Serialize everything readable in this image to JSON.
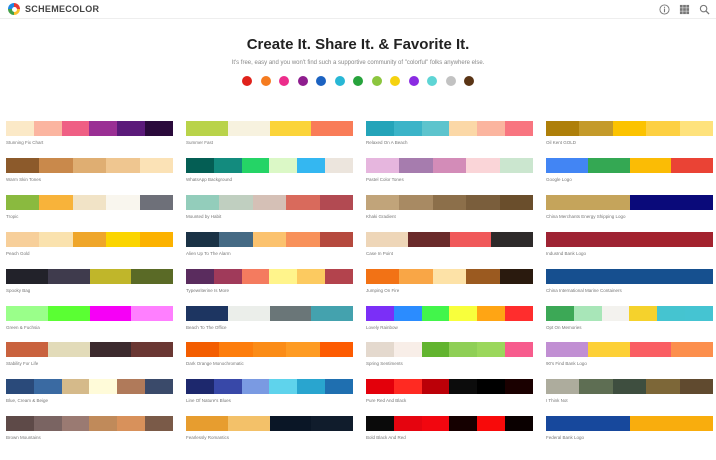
{
  "brand": {
    "name": "SCHEMECOLOR"
  },
  "header_icons": [
    "info-icon",
    "grid-icon",
    "search-icon"
  ],
  "hero": {
    "title": "Create It. Share It. & Favorite It.",
    "subtitle": "It's free, easy and you won't find such a supportive community of \"colorful\" folks anywhere else."
  },
  "color_filters": [
    "#e0221b",
    "#f57c20",
    "#ec2d8b",
    "#8e1d8e",
    "#1b62c1",
    "#28b7d5",
    "#27a33c",
    "#8cc63f",
    "#f5d20f",
    "#8a2be2",
    "#5ed5d5",
    "#c2c2c2",
    "#5a3415"
  ],
  "columns": [
    [
      {
        "name": "Stunning Fix Chart",
        "colors": [
          "#fbe9c7",
          "#fbb5a0",
          "#ef5f84",
          "#9a2f94",
          "#5b1a7a",
          "#2a0a3b"
        ]
      },
      {
        "name": "Warm Skin Tones",
        "colors": [
          "#8c5a2b",
          "#c9894b",
          "#dfae72",
          "#efc690",
          "#fbe2b6"
        ]
      },
      {
        "name": "Tropic",
        "colors": [
          "#8aba3f",
          "#f8b33a",
          "#f1e3c6",
          "#f9f6ee",
          "#6e7079"
        ]
      },
      {
        "name": "Peach Gold",
        "colors": [
          "#f7cf9a",
          "#fae2ae",
          "#efa62a",
          "#fbd500",
          "#fcb200"
        ]
      },
      {
        "name": "Spooky Bag",
        "colors": [
          "#22222a",
          "#3f3b4d",
          "#c0b62a",
          "#5a6a26"
        ]
      },
      {
        "name": "Green & Fuchsia",
        "colors": [
          "#9aff8a",
          "#5aff33",
          "#f600f6",
          "#ff7fff"
        ]
      },
      {
        "name": "Stability For Life",
        "colors": [
          "#c9623e",
          "#e2dbb9",
          "#3c2a2e",
          "#6a3733"
        ]
      },
      {
        "name": "Blue, Cream & Beige",
        "colors": [
          "#2a4a7a",
          "#3a6aa2",
          "#d5ba8a",
          "#fffbd9",
          "#b07a5a",
          "#3a4a6a"
        ]
      },
      {
        "name": "Brown Mountains",
        "colors": [
          "#5e4a48",
          "#7a6462",
          "#9a7a72",
          "#c08a5a",
          "#d8915b",
          "#7a5a48"
        ]
      }
    ],
    [
      {
        "name": "Summer Fast",
        "colors": [
          "#b9d34a",
          "#f7f2df",
          "#fbd43a",
          "#f97c58"
        ]
      },
      {
        "name": "WhatsApp Background",
        "colors": [
          "#045e54",
          "#138b7e",
          "#25d466",
          "#dbf8c6",
          "#34b7f1",
          "#ece5dd"
        ]
      },
      {
        "name": "Mounted by Habit",
        "colors": [
          "#93cdbb",
          "#c0cfc0",
          "#d5c0b6",
          "#d96a5c",
          "#b24a52"
        ]
      },
      {
        "name": "Alien Up To The Alarm",
        "colors": [
          "#1a3245",
          "#456a84",
          "#fbc26e",
          "#f8915a",
          "#b5493e"
        ]
      },
      {
        "name": "Typewriterine Is More",
        "colors": [
          "#5a2c5e",
          "#a03a5a",
          "#f47b5f",
          "#fff48b",
          "#fcca60",
          "#b3434d"
        ]
      },
      {
        "name": "Beach To The Office",
        "colors": [
          "#1d3561",
          "#ebeeea",
          "#6a7678",
          "#44a2ae"
        ]
      },
      {
        "name": "Dark Orange Monochromatic",
        "colors": [
          "#f35d00",
          "#fd7d0c",
          "#fb8c17",
          "#fe9b23",
          "#fd5b01"
        ]
      },
      {
        "name": "Line Of Nature's Blues",
        "colors": [
          "#1d286d",
          "#3848a8",
          "#7a9ae2",
          "#5fd3ec",
          "#29a5cf",
          "#1f6fb0"
        ]
      },
      {
        "name": "Fearlessly Romantics",
        "colors": [
          "#e79d2f",
          "#f3c169",
          "#0a1626",
          "#101c2c"
        ]
      }
    ],
    [
      {
        "name": "Relaxed On A Beach",
        "colors": [
          "#24a4b9",
          "#3bb4c8",
          "#5dc4cd",
          "#fbd8a7",
          "#fbb59f",
          "#f87580"
        ]
      },
      {
        "name": "Pastel Color Tones",
        "colors": [
          "#e6b6de",
          "#a67cae",
          "#d38cb8",
          "#fad5d8",
          "#cbe6cf"
        ]
      },
      {
        "name": "Khaki Gradient",
        "colors": [
          "#c1a47a",
          "#a88a63",
          "#8c6f4a",
          "#7a5e3c",
          "#6a4e2c"
        ]
      },
      {
        "name": "Case In Point",
        "colors": [
          "#eed6b8",
          "#6a2a2a",
          "#f0595a",
          "#2e2a2a"
        ]
      },
      {
        "name": "Jumping On Fire",
        "colors": [
          "#f27215",
          "#f9a646",
          "#fde2a7",
          "#9b5a20",
          "#2a1a0e"
        ]
      },
      {
        "name": "Lovely Rainbow",
        "colors": [
          "#7b2ff7",
          "#2b8cff",
          "#42f54b",
          "#f8ff3c",
          "#ffa514",
          "#ff2d2d"
        ]
      },
      {
        "name": "Spring Sentiments",
        "colors": [
          "#e4d9ce",
          "#f8eee8",
          "#62b42f",
          "#8fcf56",
          "#9bd75c",
          "#f75c8d"
        ]
      },
      {
        "name": "Pure Red And Black",
        "colors": [
          "#e3000b",
          "#ff2a22",
          "#bb0008",
          "#0c0c0c",
          "#000000",
          "#1a0000"
        ]
      },
      {
        "name": "Bold Black And Red",
        "colors": [
          "#0a0a0a",
          "#e5040f",
          "#f2060f",
          "#150000",
          "#f80a0a",
          "#0a0000"
        ]
      }
    ],
    [
      {
        "name": "Oil Kent GOLD",
        "colors": [
          "#ae7f0a",
          "#c49a2a",
          "#fcc300",
          "#fdd042",
          "#fee27c"
        ]
      },
      {
        "name": "Google Logo",
        "colors": [
          "#4285f4",
          "#34a853",
          "#fbbc05",
          "#ea4335"
        ]
      },
      {
        "name": "China Merchants Energy Shipping Logo",
        "colors": [
          "#c5a45b",
          "#0a0a7a"
        ]
      },
      {
        "name": "IndusInd Bank Logo",
        "colors": [
          "#9e2333",
          "#a3222e"
        ]
      },
      {
        "name": "China International Marine Containers",
        "colors": [
          "#164f8f",
          "#16508f"
        ]
      },
      {
        "name": "Opt On Memories",
        "colors": [
          "#3ca856",
          "#a8e6b8",
          "#f3f2ee",
          "#f5d22c",
          "#45c4d0",
          "#45c4d2"
        ]
      },
      {
        "name": "90's Find Bank Logo",
        "colors": [
          "#c18fd3",
          "#fdd036",
          "#fa5e63",
          "#fc8f4d"
        ]
      },
      {
        "name": "I Think Not",
        "colors": [
          "#adac9d",
          "#5e6e53",
          "#3e4e3f",
          "#7d6738",
          "#604a2f"
        ]
      },
      {
        "name": "Federal Bank Logo",
        "colors": [
          "#17489c",
          "#f9ad0d"
        ]
      }
    ]
  ]
}
